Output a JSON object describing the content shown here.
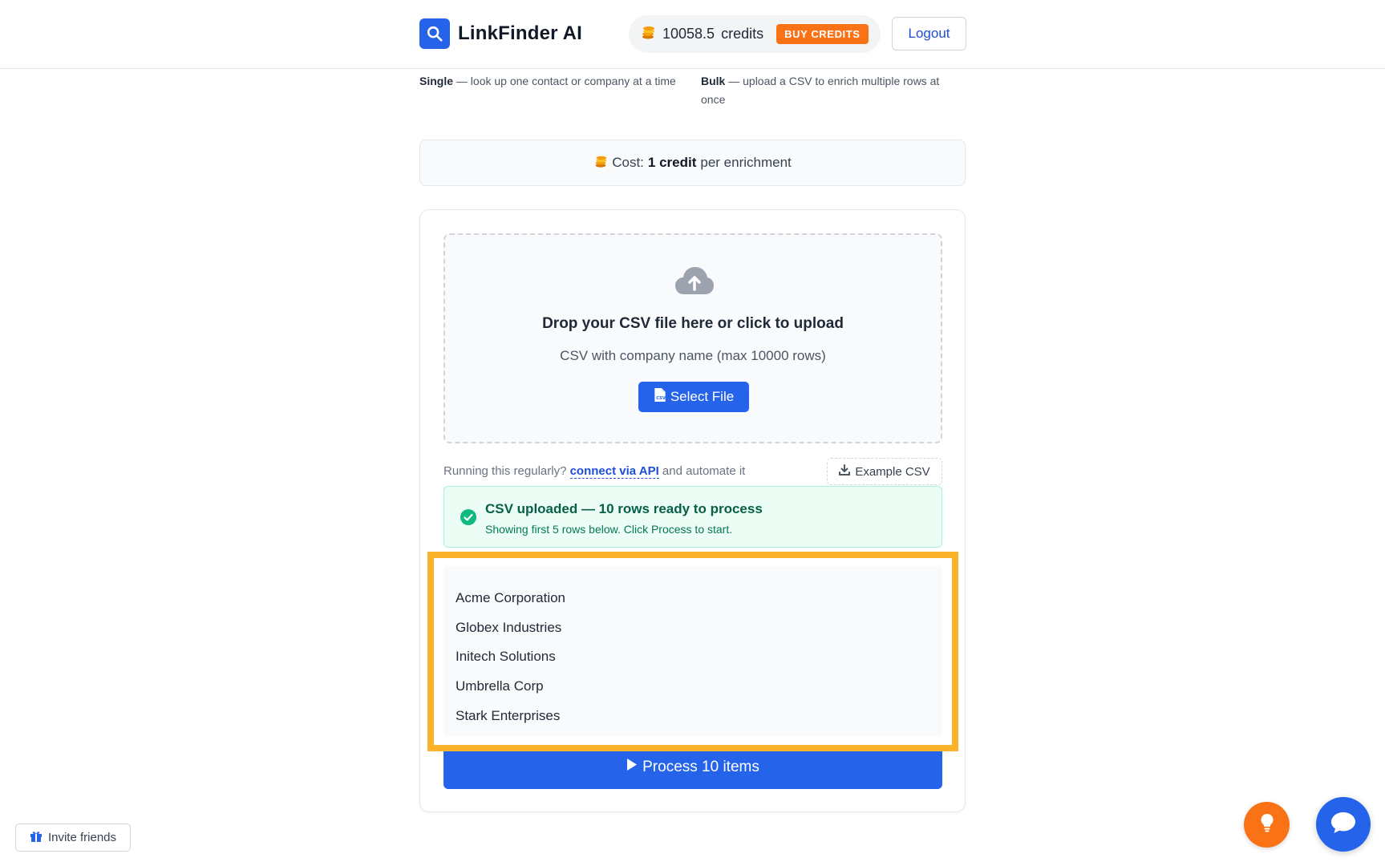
{
  "header": {
    "brand_name": "LinkFinder AI",
    "credits_amount": "10058.5",
    "credits_label": "credits",
    "buy_label": "BUY CREDITS",
    "logout_label": "Logout"
  },
  "modes": {
    "single": {
      "name": "Single",
      "desc": "— look up one contact or company at a time"
    },
    "bulk": {
      "name": "Bulk",
      "desc": "— upload a CSV to enrich multiple rows at once"
    }
  },
  "cost": {
    "prefix": "Cost:",
    "amount": "1 credit",
    "suffix": "per enrichment"
  },
  "dropzone": {
    "title": "Drop your CSV file here or click to upload",
    "subtitle": "CSV with company name (max 10000 rows)",
    "select_label": "Select File"
  },
  "api": {
    "prefix": "Running this regularly?",
    "link": "connect via API",
    "suffix": "and automate it"
  },
  "example_label": "Example CSV",
  "upload_status": {
    "title": "CSV uploaded — 10 rows ready to process",
    "subtitle": "Showing first 5 rows below. Click Process to start."
  },
  "preview_rows": [
    "Acme Corporation",
    "Globex Industries",
    "Initech Solutions",
    "Umbrella Corp",
    "Stark Enterprises"
  ],
  "process_label": "Process 10 items",
  "invite_label": "Invite friends",
  "colors": {
    "primary": "#2563eb",
    "accent": "#f97316",
    "success": "#10b981",
    "highlight": "#fbb22b"
  }
}
